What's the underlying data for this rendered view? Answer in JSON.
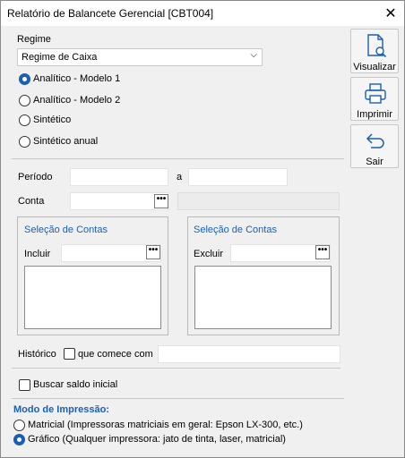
{
  "window": {
    "title": "Relatório de Balancete Gerencial [CBT004]",
    "close_glyph": "✕"
  },
  "regime": {
    "label": "Regime",
    "selected": "Regime de Caixa",
    "options": [
      "Analítico - Modelo 1",
      "Analítico - Modelo 2",
      "Sintético",
      "Sintético anual"
    ],
    "selected_option": "Analítico - Modelo 1"
  },
  "periodo": {
    "label": "Período",
    "from": "",
    "to_label": "a",
    "to": ""
  },
  "conta": {
    "label": "Conta",
    "value": "",
    "description": ""
  },
  "selecao_incluir": {
    "title": "Seleção de Contas",
    "label": "Incluir",
    "value": ""
  },
  "selecao_excluir": {
    "title": "Seleção de Contas",
    "label": "Excluir",
    "value": ""
  },
  "historico": {
    "label": "Histórico",
    "checkbox_label": "que comece com",
    "value": ""
  },
  "buscar_saldo": {
    "label": "Buscar saldo inicial"
  },
  "modo": {
    "title": "Modo de Impressão:",
    "options": [
      "Matricial (Impressoras matriciais em geral: Epson LX-300, etc.)",
      "Gráfico (Qualquer impressora: jato de tinta, laser, matricial)"
    ],
    "selected_option": "Gráfico (Qualquer impressora: jato de tinta, laser, matricial)"
  },
  "toolbar": {
    "visualizar": "Visualizar",
    "imprimir": "Imprimir",
    "sair": "Sair"
  },
  "dots_glyph": "•••",
  "chevron_glyph": "⌵",
  "colors": {
    "accent": "#1a5fb4",
    "background": "#f0f0f0"
  }
}
